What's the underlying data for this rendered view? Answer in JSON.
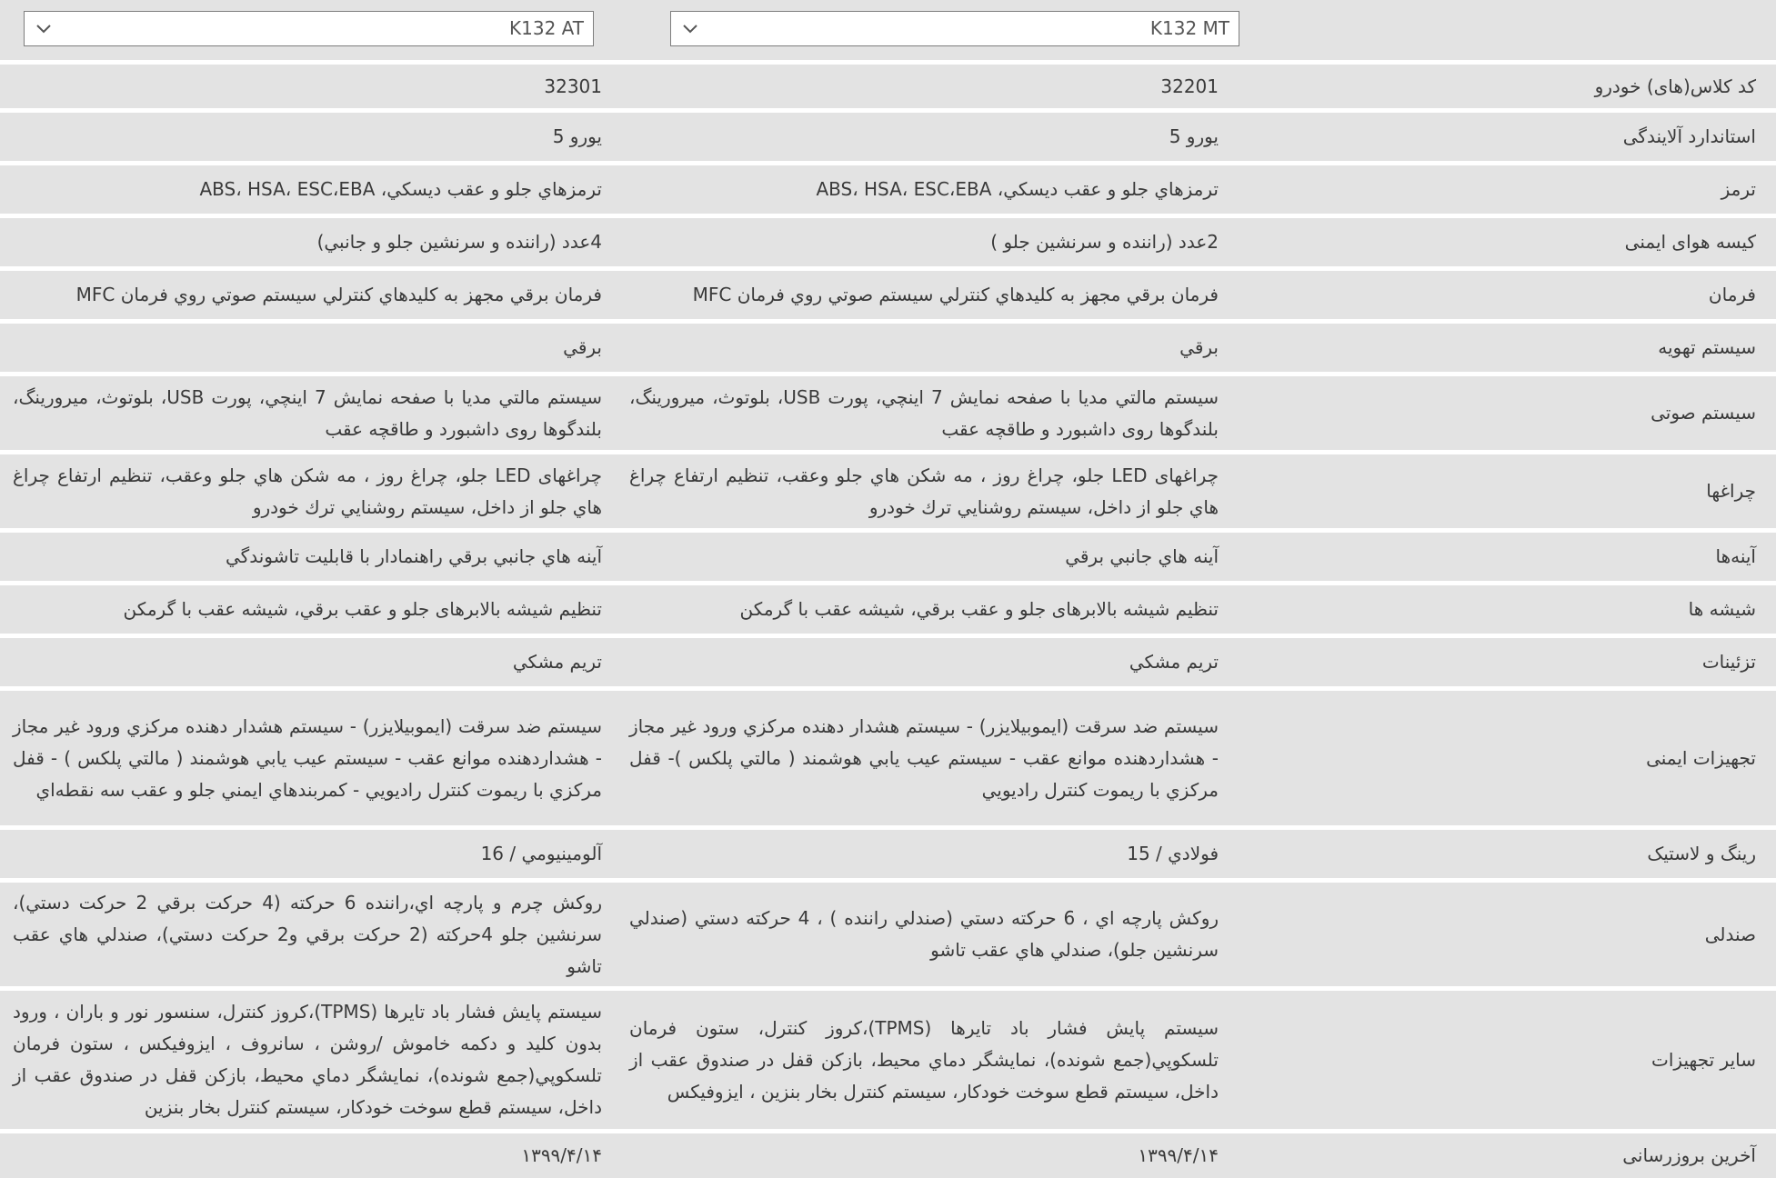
{
  "header": {
    "model_right": "K132 MT",
    "model_left": "K132 AT"
  },
  "rows": [
    {
      "label": "کد کلاس(های) خودرو",
      "mt": "32201",
      "at": "32301"
    },
    {
      "label": "استاندارد آلایندگی",
      "mt": "یورو 5",
      "at": "یورو 5"
    },
    {
      "label": "ترمز",
      "mt": "ترمزهاي جلو و عقب ديسكي، ABS، HSA، ESC،EBA",
      "at": "ترمزهاي جلو و عقب ديسكي، ABS، HSA، ESC،EBA"
    },
    {
      "label": "کیسه هوای ایمنی",
      "mt": "2عدد (راننده و سرنشين جلو )",
      "at": "4عدد (راننده و سرنشين جلو و جانبي)"
    },
    {
      "label": "فرمان",
      "mt": "فرمان برقي مجهز به كليدهاي كنترلي سيستم صوتي روي فرمان MFC",
      "at": "فرمان برقي مجهز به كليدهاي كنترلي سيستم صوتي روي فرمان MFC"
    },
    {
      "label": "سیستم تهویه",
      "mt": "برقي",
      "at": "برقي"
    },
    {
      "label": "سیستم صوتی",
      "mt": "سيستم مالتي مديا با صفحه نمايش 7 اينچي، پورت USB، بلوتوث، ميرورينگ، بلندگوها روی داشبورد و طاقچه عقب",
      "at": "سيستم مالتي مديا با صفحه نمايش 7 اينچي، پورت USB، بلوتوث، ميرورينگ، بلندگوها روی داشبورد و طاقچه عقب"
    },
    {
      "label": "چراغها",
      "mt": "چراغهای LED جلو، چراغ روز ، مه شكن هاي جلو وعقب، تنظيم ارتفاع چراغ هاي جلو از داخل، سيستم روشنايي ترك خودرو",
      "at": "چراغهای LED جلو، چراغ روز ، مه شكن هاي جلو وعقب، تنظيم ارتفاع چراغ هاي جلو از داخل، سيستم روشنايي ترك خودرو"
    },
    {
      "label": "آینه‌ها",
      "mt": "آينه هاي جانبي برقي",
      "at": "آينه هاي جانبي برقي راهنمادار با قابليت تاشوندگي"
    },
    {
      "label": "شیشه ها",
      "mt": "تنظیم شیشه بالابرهای جلو و عقب برقي، شيشه عقب با گرمكن",
      "at": "تنظیم شیشه بالابرهای جلو و عقب برقي، شيشه عقب با گرمكن"
    },
    {
      "label": "تزئینات",
      "mt": "تريم مشكي",
      "at": "تريم مشكي"
    },
    {
      "label": "تجهیزات ایمنی",
      "mt": "سيستم ضد سرقت (ايموبيلايزر) - سيستم هشدار دهنده مركزي ورود غير مجاز - هشداردهنده موانع عقب - سيستم عيب يابي هوشمند ( مالتي پلكس )- قفل مركزي با ريموت كنترل راديويي",
      "at": "سيستم ضد سرقت (ايموبيلايزر) - سيستم هشدار دهنده مركزي ورود غير مجاز - هشداردهنده موانع عقب - سيستم عيب يابي هوشمند ( مالتي پلكس ) - قفل مركزي با ريموت كنترل راديويي - كمربندهاي ايمني جلو و عقب سه نقطه‌اي"
    },
    {
      "label": "رینگ و لاستیک",
      "mt": "فولادي / 15",
      "at": "آلومينيومي / 16"
    },
    {
      "label": "صندلی",
      "mt": "روكش پارچه اي ، 6 حركته دستي (صندلي راننده ) ، 4 حركته دستي (صندلي سرنشين جلو)، صندلي هاي عقب تاشو",
      "at": "روكش چرم و پارچه اي،راننده 6 حركته (4 حركت برقي 2 حركت دستي)، سرنشين جلو 4حركته (2 حركت برقي و2 حركت دستي)، صندلي هاي عقب تاشو"
    },
    {
      "label": "سایر تجهیزات",
      "mt": "سيستم پايش فشار باد تايرها (TPMS)،كروز كنترل، ستون فرمان تلسكوپي(جمع شونده)، نمايشگر دماي محيط، بازكن قفل در صندوق عقب از داخل، سيستم قطع سوخت خودكار، سيستم كنترل بخار بنزين ، ايزوفيكس",
      "at": "سيستم پايش فشار باد تايرها (TPMS)،كروز كنترل، سنسور نور و باران ، ورود بدون كليد و دكمه خاموش /روشن ، سانروف ، ايزوفيكس ، ستون فرمان تلسكوپي(جمع شونده)، نمايشگر دماي محيط، بازكن قفل در صندوق عقب از داخل، سيستم قطع سوخت خودكار، سيستم كنترل بخار بنزين"
    },
    {
      "label": "آخرین بروزرسانی",
      "mt": "۱۳۹۹/۴/۱۴",
      "at": "۱۳۹۹/۴/۱۴"
    }
  ]
}
